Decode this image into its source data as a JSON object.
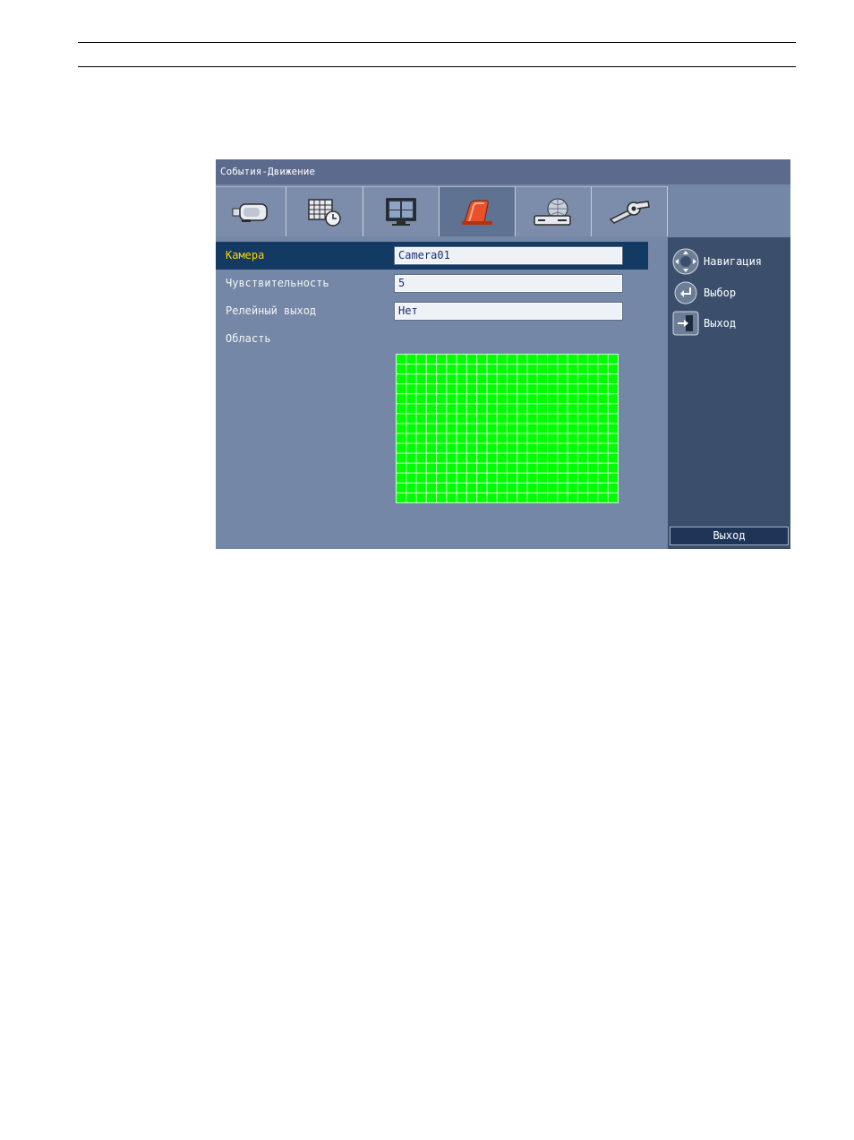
{
  "window": {
    "title": "События-Движение"
  },
  "tabs": [
    {
      "name": "camera",
      "icon": "camera-icon",
      "active": false
    },
    {
      "name": "schedule",
      "icon": "schedule-clock-icon",
      "active": false
    },
    {
      "name": "display",
      "icon": "monitor-icon",
      "active": false
    },
    {
      "name": "events",
      "icon": "alarm-icon",
      "active": true
    },
    {
      "name": "network",
      "icon": "network-globe-icon",
      "active": false
    },
    {
      "name": "system",
      "icon": "tools-icon",
      "active": false
    }
  ],
  "form": {
    "camera": {
      "label": "Камера",
      "value": "Camera01"
    },
    "sensitivity": {
      "label": "Чувствительность",
      "value": "5"
    },
    "relay": {
      "label": "Релейный выход",
      "value": "Нет"
    },
    "area": {
      "label": "Область"
    }
  },
  "motion_grid": {
    "columns": 22,
    "rows": 15,
    "active_color": "#00ff00",
    "line_color": "#c8ffc8"
  },
  "help": {
    "navigation": "Навигация",
    "select": "Выбор",
    "exit": "Выход"
  },
  "buttons": {
    "exit": "Выход"
  },
  "colors": {
    "title_bar": "#5b6a8d",
    "panel": "#7487a6",
    "side_panel": "#3b4f6d",
    "selection": "#133a63",
    "selected_label": "#ffd200",
    "field_text": "#1c2f73"
  }
}
